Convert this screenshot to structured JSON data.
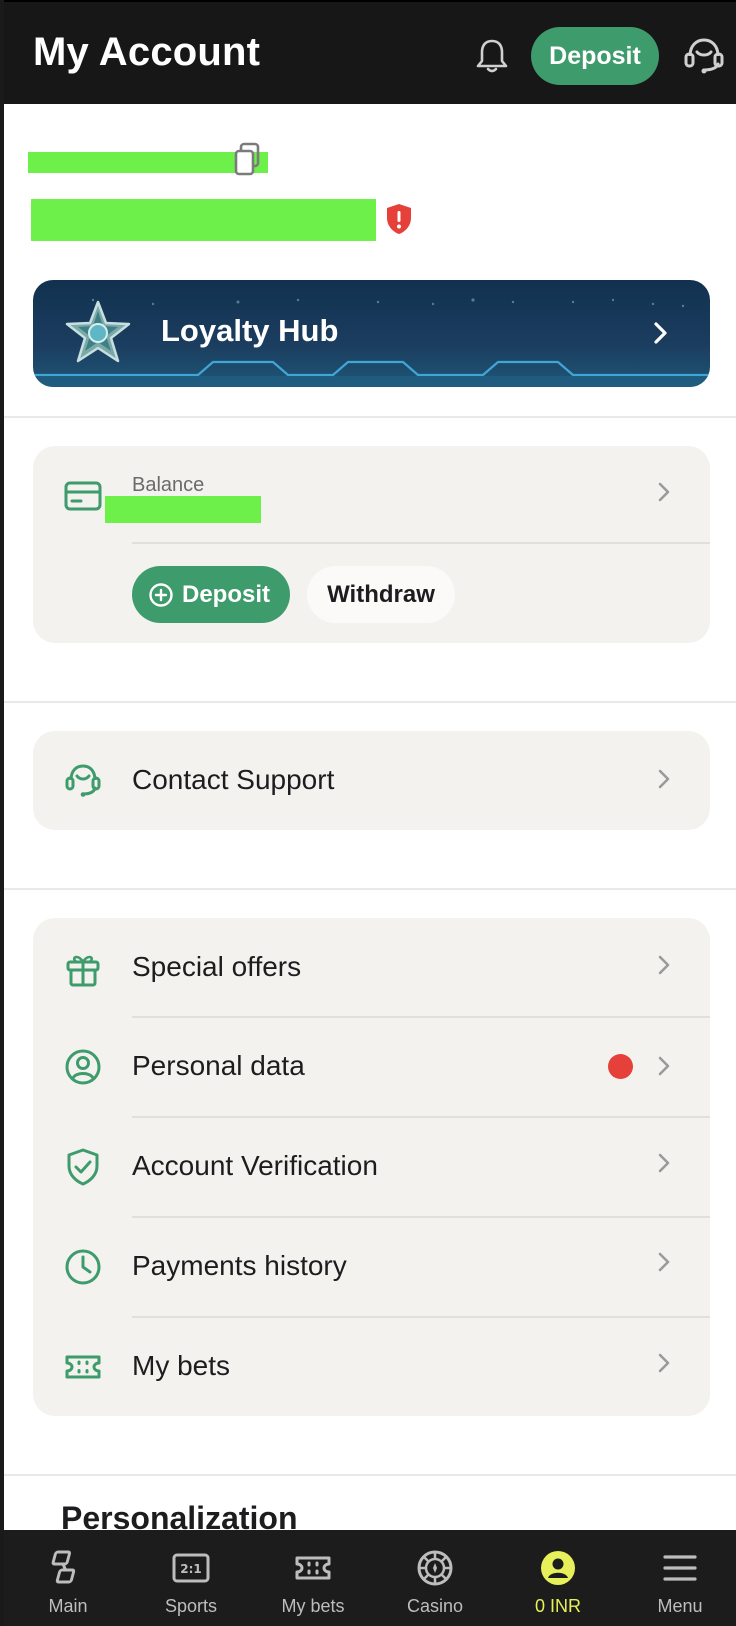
{
  "header": {
    "title": "My Account",
    "deposit_label": "Deposit"
  },
  "loyalty": {
    "title": "Loyalty Hub"
  },
  "balance_card": {
    "label": "Balance",
    "deposit_label": "Deposit",
    "withdraw_label": "Withdraw"
  },
  "support": {
    "label": "Contact Support"
  },
  "menu": {
    "items": [
      {
        "label": "Special offers",
        "icon": "gift-icon"
      },
      {
        "label": "Personal data",
        "icon": "user-circle-icon",
        "alert": true
      },
      {
        "label": "Account Verification",
        "icon": "shield-check-icon"
      },
      {
        "label": "Payments history",
        "icon": "clock-icon"
      },
      {
        "label": "My bets",
        "icon": "ticket-icon"
      }
    ]
  },
  "personalization": {
    "title": "Personalization"
  },
  "tabbar": {
    "tabs": [
      {
        "label": "Main",
        "icon": "main-icon"
      },
      {
        "label": "Sports",
        "icon": "sports-icon",
        "icon_text": "2:1"
      },
      {
        "label": "My bets",
        "icon": "ticket-icon"
      },
      {
        "label": "Casino",
        "icon": "casino-chip-icon"
      },
      {
        "label": "0 INR",
        "icon": "account-icon",
        "active": true
      },
      {
        "label": "Menu",
        "icon": "hamburger-icon"
      }
    ]
  },
  "colors": {
    "accent": "#3e9b6b",
    "header_bg": "#171717",
    "card_bg": "#f3f2ef",
    "alert": "#e5413a",
    "active_tab": "#e7f05a"
  }
}
